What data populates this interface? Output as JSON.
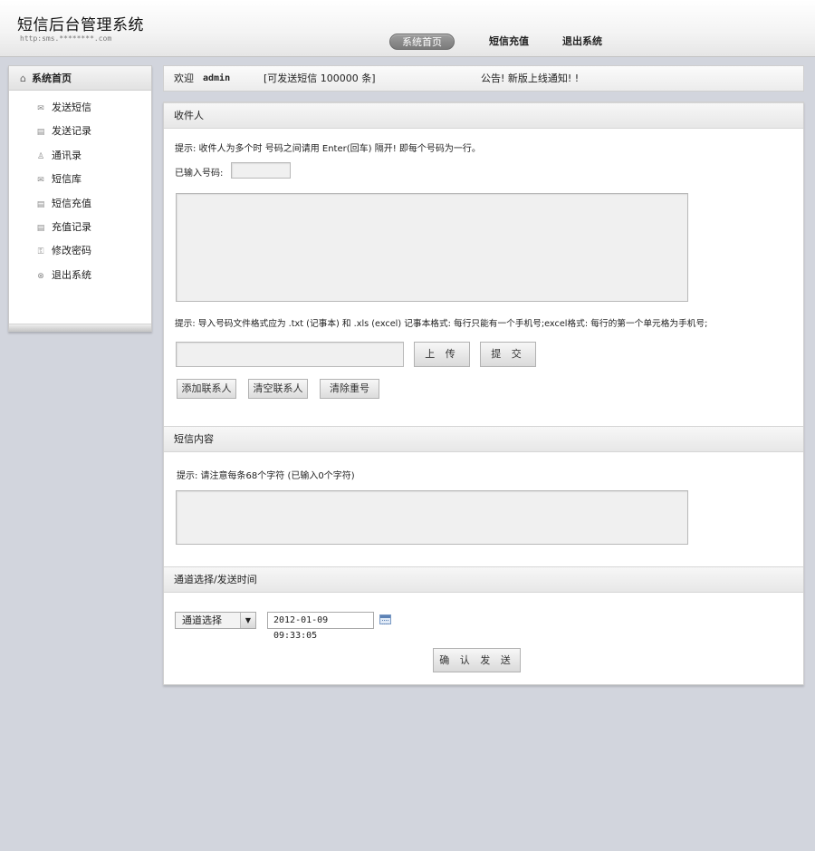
{
  "header": {
    "title": "短信后台管理系统",
    "url": "http:sms.********.com",
    "nav": [
      {
        "label": "系统首页",
        "active": true
      },
      {
        "label": "短信充值"
      },
      {
        "label": "退出系统"
      }
    ]
  },
  "sidebar": {
    "title": "系统首页",
    "title_icon": "home-icon",
    "items": [
      {
        "label": "发送短信",
        "icon": "mail-icon"
      },
      {
        "label": "发送记录",
        "icon": "record-icon"
      },
      {
        "label": "通讯录",
        "icon": "contact-icon"
      },
      {
        "label": "短信库",
        "icon": "library-icon"
      },
      {
        "label": "短信充值",
        "icon": "recharge-icon"
      },
      {
        "label": "充值记录",
        "icon": "recharge-record-icon"
      },
      {
        "label": "修改密码",
        "icon": "key-icon"
      },
      {
        "label": "退出系统",
        "icon": "logout-icon"
      }
    ]
  },
  "welcome": {
    "label": "欢迎",
    "username": "admin",
    "quota": "[可发送短信 100000 条]",
    "notice": "公告! 新版上线通知! !"
  },
  "recipients": {
    "title": "收件人",
    "hint": "提示: 收件人为多个时 号码之间请用 Enter(回车) 隔开! 即每个号码为一行。",
    "count_label": "已输入号码:",
    "count_value": "",
    "numbers_value": "",
    "import_hint": "提示: 导入号码文件格式应为 .txt (记事本) 和 .xls (excel) 记事本格式: 每行只能有一个手机号;excel格式: 每行的第一个单元格为手机号;",
    "file_value": "",
    "upload_label": "上 传",
    "submit_label": "提 交",
    "add_contact": "添加联系人",
    "clear_contact": "清空联系人",
    "dedupe": "清除重号"
  },
  "content": {
    "title": "短信内容",
    "hint": "提示: 请注意每条68个字符 (已输入0个字符)",
    "message_value": ""
  },
  "schedule": {
    "title": "通道选择/发送时间",
    "channel_selected": "通道选择",
    "datetime": "2012-01-09 09:33:05",
    "confirm_label": "确 认 发 送"
  },
  "colors": {
    "page_bg": "#d2d5dd",
    "active_nav": "#8a8a8a"
  }
}
